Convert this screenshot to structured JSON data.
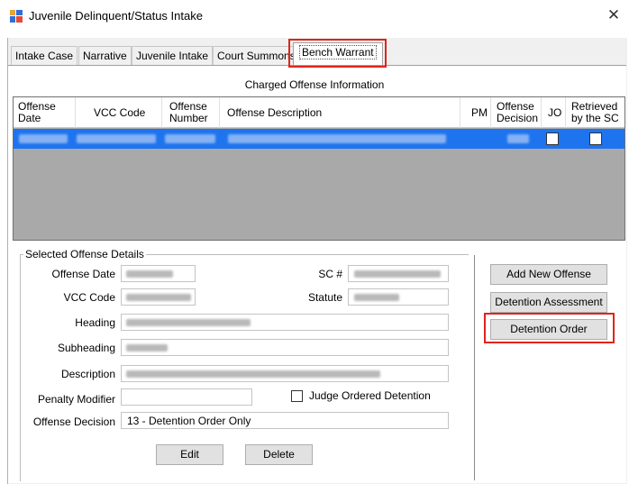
{
  "window": {
    "title": "Juvenile Delinquent/Status Intake",
    "close_glyph": "✕"
  },
  "tabs": [
    {
      "label": "Intake Case"
    },
    {
      "label": "Narrative"
    },
    {
      "label": "Juvenile Intake"
    },
    {
      "label": "Court Summons"
    },
    {
      "label": "Bench Warrant"
    }
  ],
  "active_tab": "Bench Warrant",
  "section": {
    "title": "Charged Offense Information"
  },
  "grid": {
    "columns": [
      "Offense Date",
      "VCC Code",
      "Offense Number",
      "Offense Description",
      "PM",
      "Offense Decision",
      "JO",
      "Retrieved by the SC"
    ],
    "selected_row_jo_checked": false,
    "selected_row_retrieved_checked": false
  },
  "details": {
    "group_label": "Selected Offense Details",
    "labels": {
      "offense_date": "Offense Date",
      "sc": "SC #",
      "vcc_code": "VCC Code",
      "statute": "Statute",
      "heading": "Heading",
      "subheading": "Subheading",
      "description": "Description",
      "penalty_modifier": "Penalty Modifier",
      "offense_decision": "Offense Decision"
    },
    "judge_ordered_detention": {
      "label": "Judge Ordered Detention",
      "checked": false
    },
    "offense_decision_value": "13 - Detention Order Only",
    "penalty_modifier_value": ""
  },
  "buttons": {
    "edit": "Edit",
    "delete": "Delete",
    "add_new_offense": "Add New Offense",
    "detention_assessment": "Detention Assessment",
    "detention_order": "Detention Order"
  },
  "colors": {
    "highlight": "#e0241b",
    "selection": "#1e74ef"
  }
}
